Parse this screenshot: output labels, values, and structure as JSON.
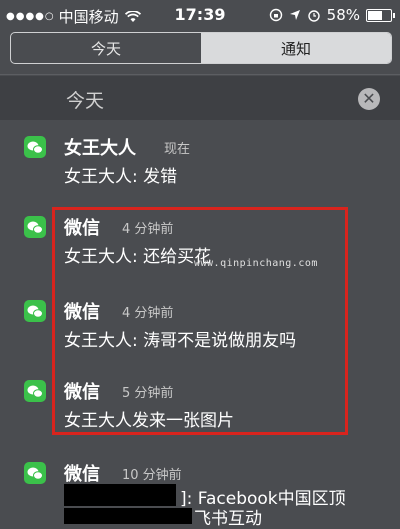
{
  "status_bar": {
    "signal_dots": "●●●●○",
    "carrier": "中国移动",
    "wifi_icon": "wifi-icon",
    "time": "17:39",
    "battery_percent": "58%",
    "battery_level": 0.58
  },
  "tabs": [
    {
      "label": "今天",
      "selected": false
    },
    {
      "label": "通知",
      "selected": true
    }
  ],
  "section": {
    "title": "今天",
    "clear_icon": "close-icon"
  },
  "notifications": [
    {
      "app": "女王大人",
      "time": "现在",
      "message": "女王大人: 发错"
    },
    {
      "app": "微信",
      "time": "4 分钟前",
      "message": "女王大人: 还给买花"
    },
    {
      "app": "微信",
      "time": "4 分钟前",
      "message": "女王大人: 涛哥不是说做朋友吗"
    },
    {
      "app": "微信",
      "time": "5 分钟前",
      "message": "女王大人发来一张图片"
    },
    {
      "app": "微信",
      "time": "10 分钟前",
      "message": "]: Facebook中国区顶",
      "message2": "飞书互动"
    }
  ],
  "watermark": "www.qinpinchang.com",
  "colors": {
    "highlight": "#d9241d",
    "wechat_green": "#3bc14a"
  }
}
